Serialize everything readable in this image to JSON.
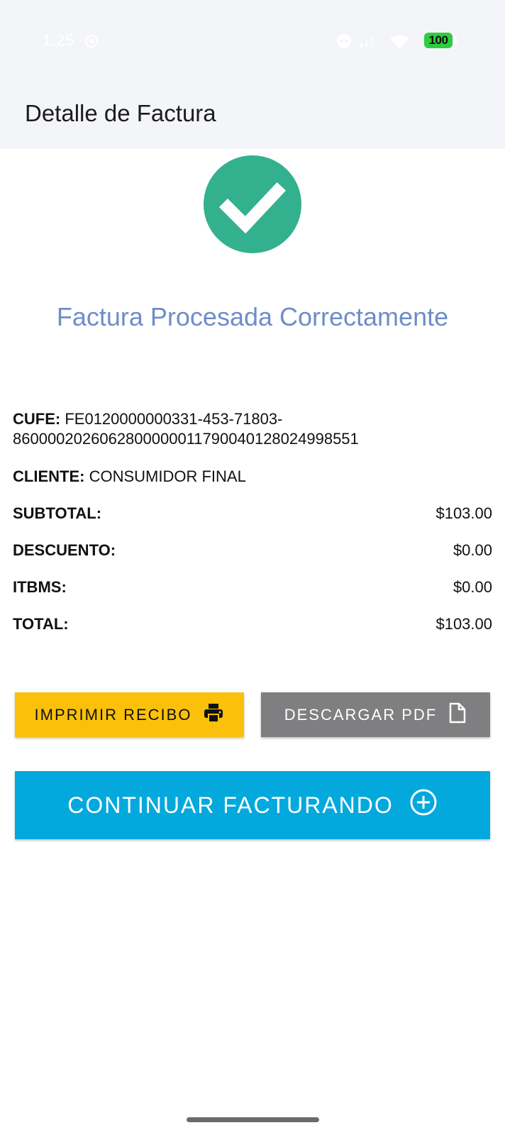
{
  "status_bar": {
    "time": "1:25",
    "battery": "100"
  },
  "header": {
    "title": "Detalle de Factura"
  },
  "result": {
    "message": "Factura Procesada Correctamente",
    "success_color": "#33b18e"
  },
  "invoice": {
    "cufe_label": "CUFE:",
    "cufe_value_line1": "FE0120000000331-453-71803-",
    "cufe_value_line2": "8600002026062800000011790040128024998551",
    "cliente_label": "CLIENTE:",
    "cliente_value": "CONSUMIDOR FINAL",
    "subtotal_label": "SUBTOTAL:",
    "subtotal_value": "$103.00",
    "descuento_label": "DESCUENTO:",
    "descuento_value": "$0.00",
    "itbms_label": "ITBMS:",
    "itbms_value": "$0.00",
    "total_label": "TOTAL:",
    "total_value": "$103.00"
  },
  "actions": {
    "print_label": "IMPRIMIR RECIBO",
    "pdf_label": "DESCARGAR PDF",
    "continue_label": "CONTINUAR FACTURANDO",
    "print_color": "#fbc10a",
    "pdf_color": "#7f7f81",
    "continue_color": "#03a9dc"
  }
}
